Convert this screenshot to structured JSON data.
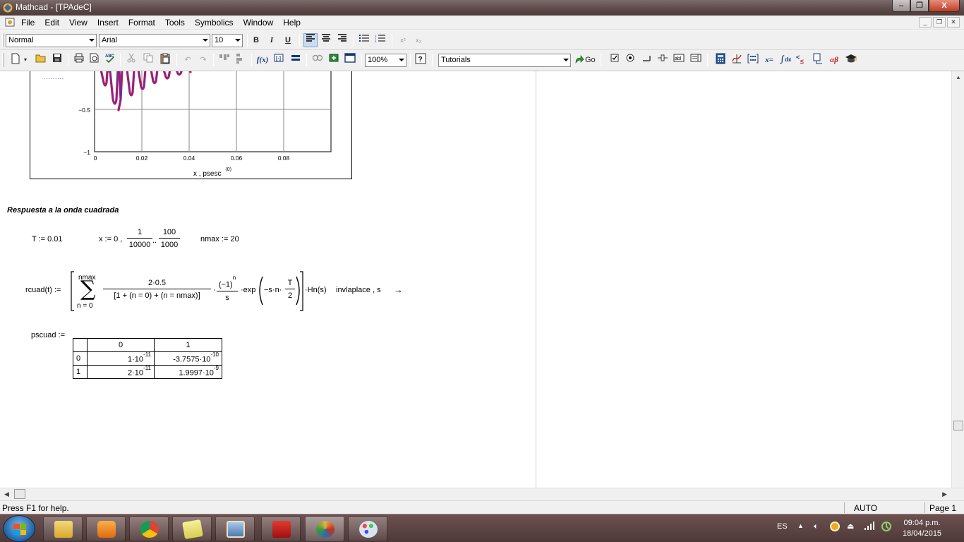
{
  "window": {
    "title": "Mathcad - [TPAdeC]",
    "buttons": {
      "minimize": "–",
      "restore": "❐",
      "close": "X"
    }
  },
  "menu": {
    "items": [
      "File",
      "Edit",
      "View",
      "Insert",
      "Format",
      "Tools",
      "Symbolics",
      "Window",
      "Help"
    ]
  },
  "format_toolbar": {
    "style": "Normal",
    "font": "Arial",
    "size": "10",
    "bold": "B",
    "italic": "I",
    "underline": "U",
    "superscript": "x²",
    "subscript": "x₂"
  },
  "standard_toolbar": {
    "zoom": "100%",
    "resources": "Tutorials",
    "go_label": "Go",
    "fx_label": "f(x)",
    "xeq_label": "x=",
    "alpha_beta": "αβ"
  },
  "plot": {
    "legend_dots": "·········",
    "y_ticks": [
      "−0.5",
      "−1"
    ],
    "x_ticks": [
      "0",
      "0.02",
      "0.04",
      "0.06",
      "0.08"
    ],
    "x_label": "x , psesc",
    "x_label_sup": "⟨0⟩",
    "series_colors": {
      "red": "#d4143c",
      "blue": "#3a3ad6"
    }
  },
  "worksheet": {
    "heading": "Respuesta a la onda cuadrada",
    "T_def": "T := 0.01",
    "x_def_prefix": "x := 0 ,",
    "x_frac1": {
      "num": "1",
      "den": "10000"
    },
    "x_range_dots": "..",
    "x_frac2": {
      "num": "100",
      "den": "1000"
    },
    "nmax_def": "nmax := 20",
    "rcuad_lhs": "rcuad(t) :=",
    "sum_top": "nmax",
    "sum_symbol": "∑",
    "sum_bottom": "n = 0",
    "frac_a": {
      "num": "2·0.5",
      "den": "[1 + (n = 0) + (n = nmax)]"
    },
    "mult_dot": "·",
    "frac_b": {
      "num": "(−1)",
      "num_sup": "n",
      "den": "s"
    },
    "exp_label": "·exp",
    "exp_inner": "−s·n·",
    "frac_c": {
      "num": "T",
      "den": "2"
    },
    "hn": "·Hn(s)",
    "invlaplace": "invlaplace , s",
    "arrow": "→",
    "pscuad_lhs": "pscuad :=",
    "matrix": {
      "col_headers": [
        "0",
        "1"
      ],
      "rows": [
        {
          "index": "0",
          "c0_mant": "1·10",
          "c0_exp": "-11",
          "c1_mant": "-3.7575·10",
          "c1_exp": "-10"
        },
        {
          "index": "1",
          "c0_mant": "2·10",
          "c0_exp": "-11",
          "c1_mant": "1.9997·10",
          "c1_exp": "-9"
        }
      ]
    }
  },
  "status": {
    "help": "Press F1 for help.",
    "mode": "AUTO",
    "page": "Page 1"
  },
  "taskbar": {
    "language": "ES",
    "time": "09:04 p.m.",
    "date": "18/04/2015",
    "apps": [
      {
        "name": "explorer",
        "color": "#e8c34a"
      },
      {
        "name": "media-player",
        "color": "#f0872a"
      },
      {
        "name": "chrome",
        "color": "#3c9b3c"
      },
      {
        "name": "sticky-notes",
        "color": "#d9d36a"
      },
      {
        "name": "image-viewer",
        "color": "#7aa6d4"
      },
      {
        "name": "acrobat",
        "color": "#c8201c"
      },
      {
        "name": "mathcad",
        "color": "#b0492a"
      },
      {
        "name": "paint",
        "color": "#6ea3d8"
      }
    ]
  }
}
